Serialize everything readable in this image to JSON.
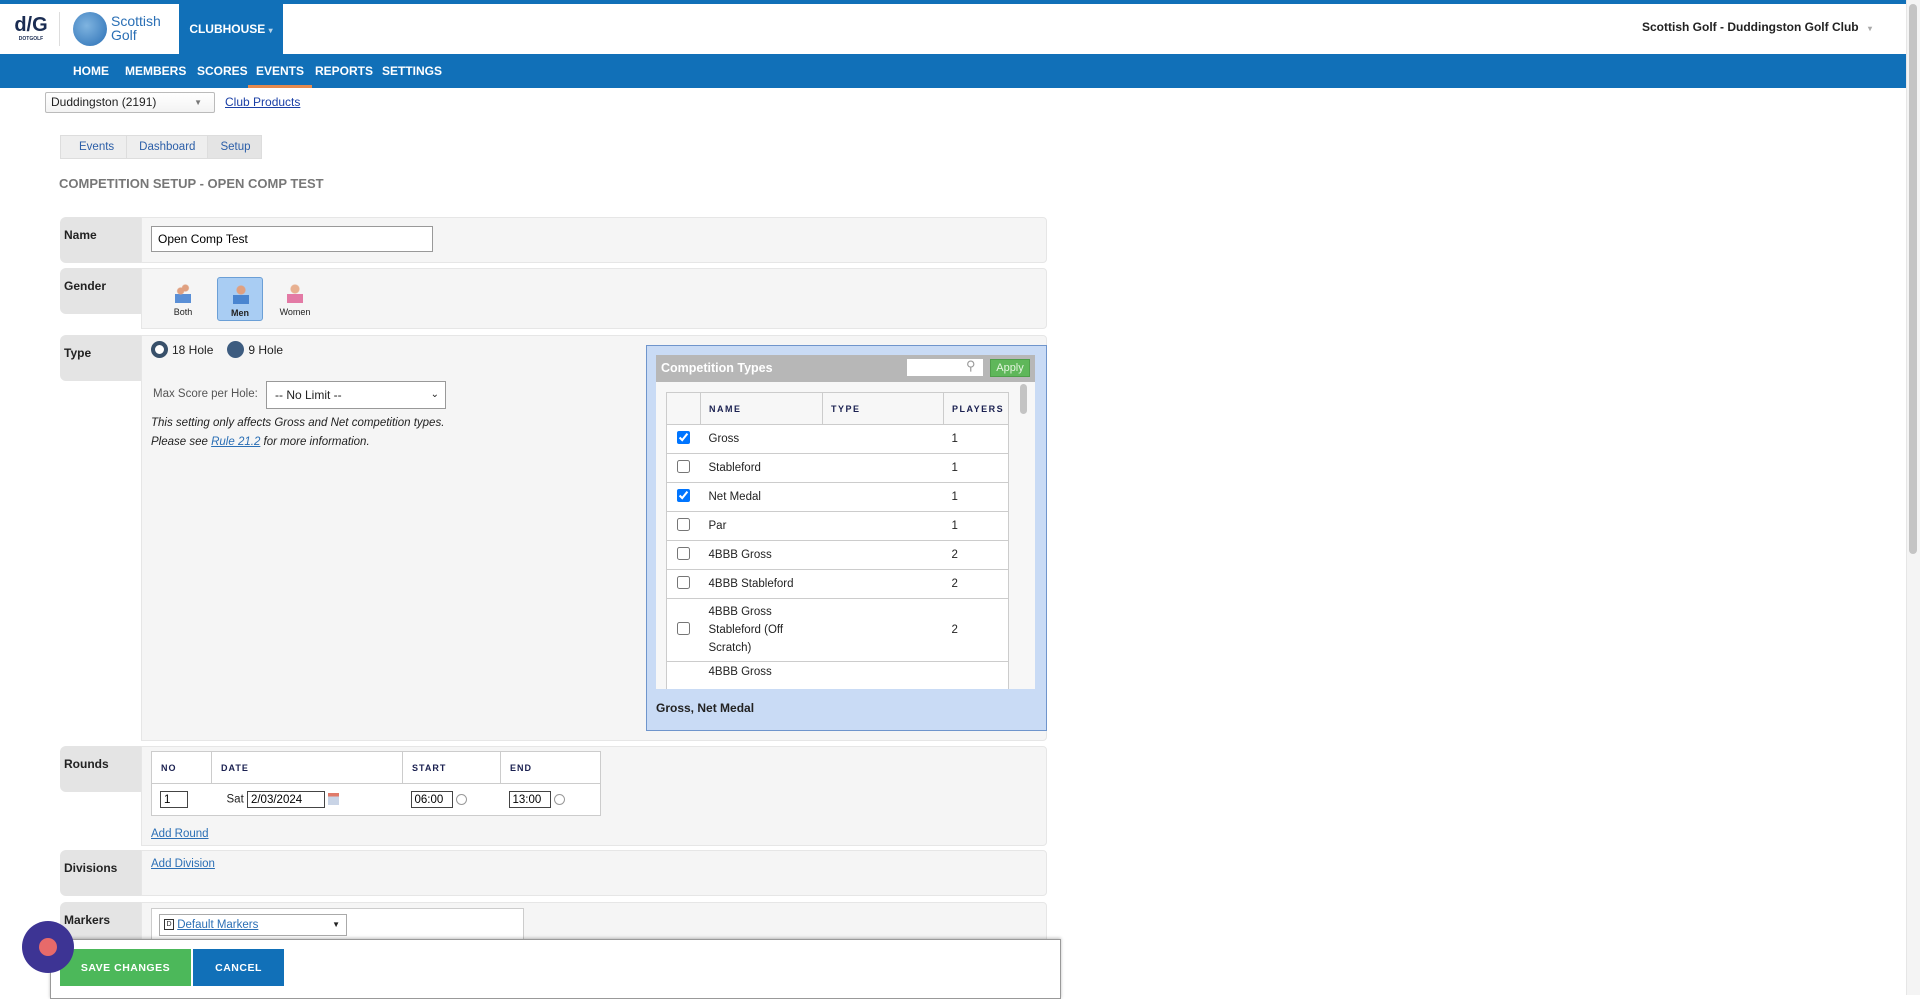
{
  "header": {
    "brand_dotgolf": "DOTGOLF",
    "brand_scottish": "Scottish",
    "brand_golf": "Golf",
    "clubhouse": "CLUBHOUSE",
    "account": "Scottish Golf - Duddingston Golf Club"
  },
  "nav": {
    "items": [
      "HOME",
      "MEMBERS",
      "SCORES",
      "EVENTS",
      "REPORTS",
      "SETTINGS"
    ],
    "active": "EVENTS"
  },
  "club_select": {
    "value": "Duddingston (2191)"
  },
  "club_products": "Club Products",
  "breadcrumb": [
    "Events",
    "Dashboard",
    "Setup"
  ],
  "page_title": "COMPETITION SETUP - OPEN COMP TEST",
  "name": {
    "label": "Name",
    "value": "Open Comp Test"
  },
  "gender": {
    "label": "Gender",
    "options": [
      "Both",
      "Men",
      "Women"
    ],
    "selected": "Men"
  },
  "type": {
    "label": "Type",
    "options": [
      "18 Hole",
      "9 Hole"
    ],
    "selected": "18 Hole",
    "max_score_label": "Max Score per Hole:",
    "max_score_value": "-- No Limit --",
    "note1": "This setting only affects Gross and Net competition types.",
    "note2_pre": "Please see ",
    "note2_link": "Rule 21.2",
    "note2_post": " for more information."
  },
  "competition_types": {
    "title": "Competition Types",
    "search_placeholder": "",
    "apply": "Apply",
    "columns": [
      "NAME",
      "TYPE",
      "PLAYERS"
    ],
    "rows": [
      {
        "name": "Gross",
        "type": "",
        "players": "1",
        "checked": true
      },
      {
        "name": "Stableford",
        "type": "",
        "players": "1",
        "checked": false
      },
      {
        "name": "Net Medal",
        "type": "",
        "players": "1",
        "checked": true
      },
      {
        "name": "Par",
        "type": "",
        "players": "1",
        "checked": false
      },
      {
        "name": "4BBB Gross",
        "type": "",
        "players": "2",
        "checked": false
      },
      {
        "name": "4BBB Stableford",
        "type": "",
        "players": "2",
        "checked": false
      },
      {
        "name": "4BBB Gross Stableford (Off Scratch)",
        "type": "",
        "players": "2",
        "checked": false
      },
      {
        "name": "4BBB Gross",
        "type": "",
        "players": "",
        "checked": false
      }
    ],
    "selected_summary": "Gross, Net Medal"
  },
  "rounds": {
    "label": "Rounds",
    "columns": [
      "NO",
      "DATE",
      "START",
      "END"
    ],
    "rows": [
      {
        "no": "1",
        "day": "Sat",
        "date": "2/03/2024",
        "start": "06:00",
        "end": "13:00"
      }
    ],
    "add": "Add Round"
  },
  "divisions": {
    "label": "Divisions",
    "add": "Add Division"
  },
  "markers": {
    "label": "Markers",
    "value": "Default Markers"
  },
  "actions": {
    "save": "SAVE CHANGES",
    "cancel": "CANCEL"
  },
  "colors": {
    "brand_blue": "#1170b8",
    "save_green": "#4cb85a",
    "panel_blue": "#c9dbf5",
    "active_tab": "#e58a4e"
  }
}
